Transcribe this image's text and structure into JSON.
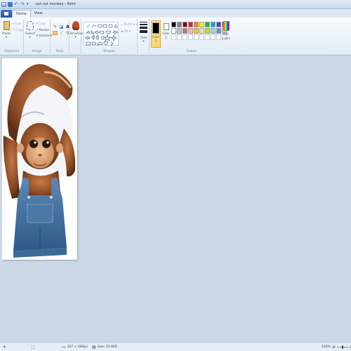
{
  "window": {
    "title": "out out monkey - Paint"
  },
  "menu": {
    "tabs": [
      "Home",
      "View"
    ]
  },
  "ribbon": {
    "clipboard": {
      "paste": "Paste",
      "cut": "Cut",
      "copy": "Copy",
      "group": "Clipboard"
    },
    "image": {
      "select": "Select",
      "crop": "Crop",
      "resize": "Resize",
      "rotate": "Rotate",
      "group": "Image"
    },
    "tools": {
      "group": "Tools",
      "brushes": "Brushes"
    },
    "shapes": {
      "outline": "Outline",
      "fill": "Fill",
      "group": "Shapes"
    },
    "size": {
      "label": "Size"
    },
    "colors": {
      "color1": "Color 1",
      "color2": "Color 2",
      "edit": "Edit colors",
      "group": "Colors",
      "color1_value": "#000000",
      "color2_value": "#ffffff",
      "palette_row1": [
        "#000000",
        "#7f7f7f",
        "#880015",
        "#ed1c24",
        "#ff7f27",
        "#fff200",
        "#22b14c",
        "#00a2e8",
        "#3f48cc",
        "#a349a4"
      ],
      "palette_row2": [
        "#ffffff",
        "#c3c3c3",
        "#b97a57",
        "#ffaec9",
        "#ffc90e",
        "#efe4b0",
        "#b5e61d",
        "#99d9ea",
        "#7092be",
        "#c8bfe7"
      ]
    }
  },
  "status": {
    "dimensions": "107 × 489px",
    "size": "Size: 20.9KB",
    "zoom": "100%"
  }
}
